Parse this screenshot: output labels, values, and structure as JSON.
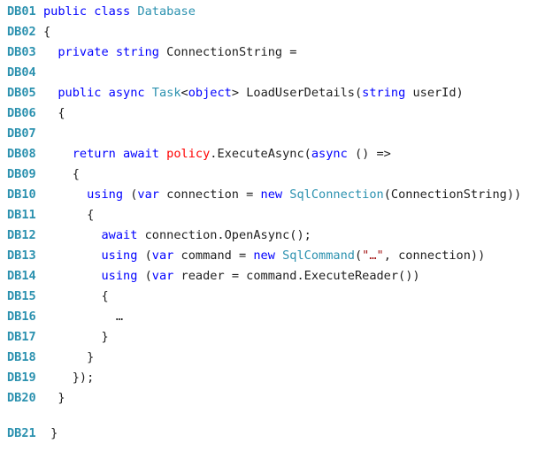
{
  "colors": {
    "line_number": "#2b91af",
    "keyword": "#0000ff",
    "type": "#2b91af",
    "plain": "#1e1e1e",
    "string": "#a31515",
    "highlight": "#ff0000"
  },
  "lines": [
    {
      "n": "DB01",
      "tokens": [
        [
          "kw",
          "public class "
        ],
        [
          "ty",
          "Database"
        ]
      ]
    },
    {
      "n": "DB02",
      "tokens": [
        [
          "pl",
          "{"
        ]
      ]
    },
    {
      "n": "DB03",
      "tokens": [
        [
          "pl",
          "  "
        ],
        [
          "kw",
          "private string"
        ],
        [
          "pl",
          " ConnectionString ="
        ]
      ]
    },
    {
      "n": "DB04",
      "tokens": []
    },
    {
      "n": "DB05",
      "tokens": [
        [
          "pl",
          "  "
        ],
        [
          "kw",
          "public async "
        ],
        [
          "ty",
          "Task"
        ],
        [
          "pl",
          "<"
        ],
        [
          "kw",
          "object"
        ],
        [
          "pl",
          "> LoadUserDetails("
        ],
        [
          "kw",
          "string"
        ],
        [
          "pl",
          " userId)"
        ]
      ]
    },
    {
      "n": "DB06",
      "tokens": [
        [
          "pl",
          "  {"
        ]
      ]
    },
    {
      "n": "DB07",
      "tokens": []
    },
    {
      "n": "DB08",
      "tokens": [
        [
          "pl",
          "    "
        ],
        [
          "kw",
          "return await "
        ],
        [
          "hl",
          "policy"
        ],
        [
          "pl",
          ".ExecuteAsync("
        ],
        [
          "kw",
          "async"
        ],
        [
          "pl",
          " () =>"
        ]
      ]
    },
    {
      "n": "DB09",
      "tokens": [
        [
          "pl",
          "    {"
        ]
      ]
    },
    {
      "n": "DB10",
      "tokens": [
        [
          "pl",
          "      "
        ],
        [
          "kw",
          "using"
        ],
        [
          "pl",
          " ("
        ],
        [
          "kw",
          "var"
        ],
        [
          "pl",
          " connection = "
        ],
        [
          "kw",
          "new "
        ],
        [
          "ty",
          "SqlConnection"
        ],
        [
          "pl",
          "(ConnectionString))"
        ]
      ]
    },
    {
      "n": "DB11",
      "tokens": [
        [
          "pl",
          "      {"
        ]
      ]
    },
    {
      "n": "DB12",
      "tokens": [
        [
          "pl",
          "        "
        ],
        [
          "kw",
          "await"
        ],
        [
          "pl",
          " connection.OpenAsync();"
        ]
      ]
    },
    {
      "n": "DB13",
      "tokens": [
        [
          "pl",
          "        "
        ],
        [
          "kw",
          "using"
        ],
        [
          "pl",
          " ("
        ],
        [
          "kw",
          "var"
        ],
        [
          "pl",
          " command = "
        ],
        [
          "kw",
          "new "
        ],
        [
          "ty",
          "SqlCommand"
        ],
        [
          "pl",
          "("
        ],
        [
          "st",
          "\"…\""
        ],
        [
          "pl",
          ", connection))"
        ]
      ]
    },
    {
      "n": "DB14",
      "tokens": [
        [
          "pl",
          "        "
        ],
        [
          "kw",
          "using"
        ],
        [
          "pl",
          " ("
        ],
        [
          "kw",
          "var"
        ],
        [
          "pl",
          " reader = command.ExecuteReader())"
        ]
      ]
    },
    {
      "n": "DB15",
      "tokens": [
        [
          "pl",
          "        {"
        ]
      ]
    },
    {
      "n": "DB16",
      "tokens": [
        [
          "pl",
          "          …"
        ]
      ]
    },
    {
      "n": "DB17",
      "tokens": [
        [
          "pl",
          "        }"
        ]
      ]
    },
    {
      "n": "DB18",
      "tokens": [
        [
          "pl",
          "      }"
        ]
      ]
    },
    {
      "n": "DB19",
      "tokens": [
        [
          "pl",
          "    });"
        ]
      ]
    },
    {
      "n": "DB20",
      "tokens": [
        [
          "pl",
          "  }"
        ]
      ]
    },
    {
      "n": "DB21",
      "tokens": [
        [
          "pl",
          " }"
        ]
      ],
      "gap_before": true
    }
  ]
}
